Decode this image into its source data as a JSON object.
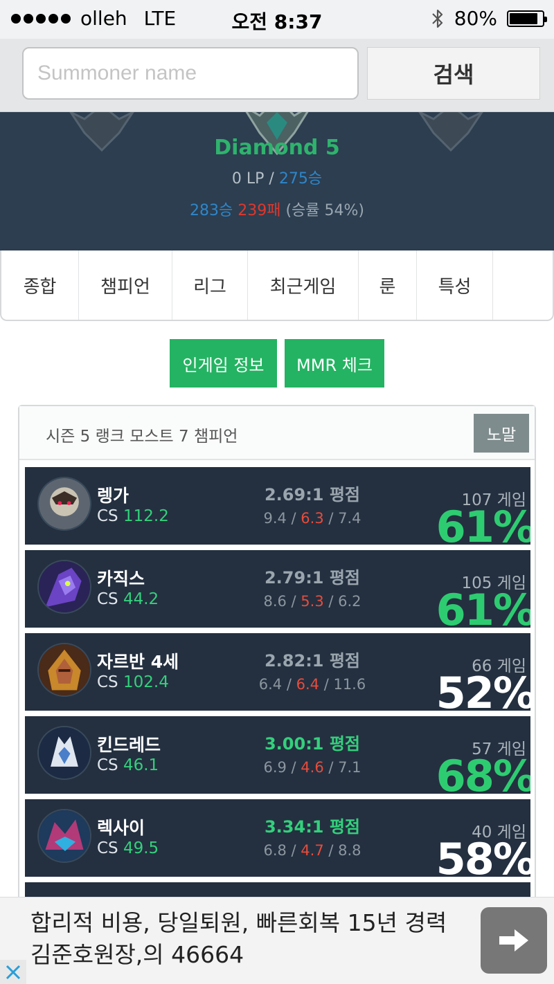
{
  "status_bar": {
    "carrier": "olleh",
    "network": "LTE",
    "time": "오전 8:37",
    "battery": "80%",
    "battery_level": 0.8,
    "signal_dots": 5,
    "icons": [
      "signal-dots-icon",
      "bluetooth-icon",
      "battery-icon"
    ]
  },
  "search": {
    "placeholder": "Summoner name",
    "value": "",
    "button_label": "검색"
  },
  "profile": {
    "tier": "Diamond 5",
    "lp": "0 LP",
    "lp_separator": " / ",
    "tier_wins": "275승",
    "wins": "283승",
    "losses": "239패",
    "winrate_text": "(승률 54%)",
    "icons": [
      "diamond-crest-icon"
    ]
  },
  "tabs": [
    {
      "label": "종합"
    },
    {
      "label": "챔피언"
    },
    {
      "label": "리그"
    },
    {
      "label": "최근게임"
    },
    {
      "label": "룬"
    },
    {
      "label": "특성"
    },
    {
      "label": ""
    }
  ],
  "actions": {
    "ingame_label": "인게임 정보",
    "mmr_label": "MMR 체크"
  },
  "panel": {
    "title": "시즌 5 랭크 모스트 7 챔피언",
    "mode_button": "노말"
  },
  "champions": [
    {
      "name": "렝가",
      "cs_label": "CS",
      "cs": "112.2",
      "ratio": "2.69:1 평점",
      "ratio_highlight": false,
      "kills": "9.4",
      "deaths": "6.3",
      "assists": "7.4",
      "games": "107 게임",
      "winrate": "61%",
      "winrate_color": "#2ecc71",
      "icon": "rengar-portrait-icon"
    },
    {
      "name": "카직스",
      "cs_label": "CS",
      "cs": "44.2",
      "ratio": "2.79:1 평점",
      "ratio_highlight": false,
      "kills": "8.6",
      "deaths": "5.3",
      "assists": "6.2",
      "games": "105 게임",
      "winrate": "61%",
      "winrate_color": "#2ecc71",
      "icon": "khazix-portrait-icon"
    },
    {
      "name": "자르반 4세",
      "cs_label": "CS",
      "cs": "102.4",
      "ratio": "2.82:1 평점",
      "ratio_highlight": false,
      "kills": "6.4",
      "deaths": "6.4",
      "assists": "11.6",
      "games": "66 게임",
      "winrate": "52%",
      "winrate_color": "#ffffff",
      "icon": "jarvan-portrait-icon"
    },
    {
      "name": "킨드레드",
      "cs_label": "CS",
      "cs": "46.1",
      "ratio": "3.00:1 평점",
      "ratio_highlight": true,
      "kills": "6.9",
      "deaths": "4.6",
      "assists": "7.1",
      "games": "57 게임",
      "winrate": "68%",
      "winrate_color": "#2ecc71",
      "icon": "kindred-portrait-icon"
    },
    {
      "name": "렉사이",
      "cs_label": "CS",
      "cs": "49.5",
      "ratio": "3.34:1 평점",
      "ratio_highlight": true,
      "kills": "6.8",
      "deaths": "4.7",
      "assists": "8.8",
      "games": "40 게임",
      "winrate": "58%",
      "winrate_color": "#ffffff",
      "icon": "reksai-portrait-icon"
    }
  ],
  "ad": {
    "text": "합리적 비용, 당일퇴원, 빠른회복 15년 경력 김준호원장,의 46664",
    "icons": [
      "arrow-right-icon",
      "close-icon"
    ]
  }
}
